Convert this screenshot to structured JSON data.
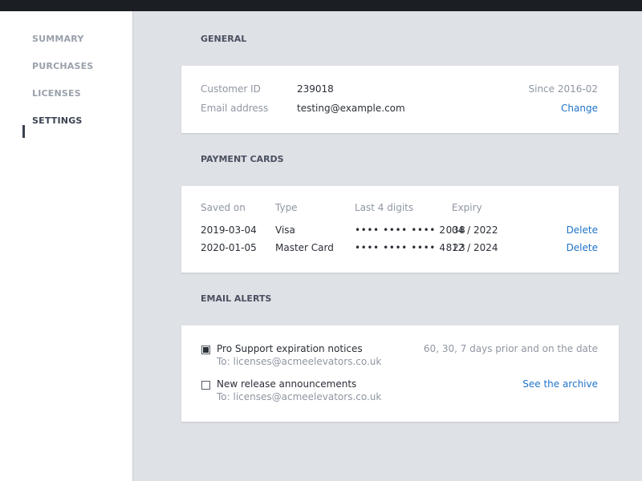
{
  "sidebar": {
    "items": [
      {
        "label": "SUMMARY"
      },
      {
        "label": "PURCHASES"
      },
      {
        "label": "LICENSES"
      },
      {
        "label": "SETTINGS"
      }
    ],
    "active_index": 3
  },
  "general": {
    "title": "GENERAL",
    "customer_id_label": "Customer ID",
    "customer_id_value": "239018",
    "since": "Since 2016-02",
    "email_label": "Email address",
    "email_value": "testing@example.com",
    "change_label": "Change"
  },
  "payment_cards": {
    "title": "PAYMENT CARDS",
    "headers": [
      "Saved on",
      "Type",
      "Last 4 digits",
      "Expiry"
    ],
    "rows": [
      {
        "saved_on": "2019-03-04",
        "type": "Visa",
        "digits": "•••• •••• •••• 2038",
        "expiry": "04 / 2022",
        "action": "Delete"
      },
      {
        "saved_on": "2020-01-05",
        "type": "Master Card",
        "digits": "•••• •••• •••• 4823",
        "expiry": "12 / 2024",
        "action": "Delete"
      }
    ]
  },
  "email_alerts": {
    "title": "EMAIL ALERTS",
    "alerts": [
      {
        "label": "Pro Support expiration notices",
        "to": "To: licenses@acmeelevators.co.uk",
        "meta": "60, 30, 7 days prior and on the date",
        "checked": true
      },
      {
        "label": "New release announcements",
        "to": "To: licenses@acmeelevators.co.uk",
        "link": "See the archive",
        "checked": false
      }
    ]
  },
  "colors": {
    "accent_link": "#1f73c8",
    "topbar": "#1b1f24",
    "background": "#dee1e6"
  }
}
